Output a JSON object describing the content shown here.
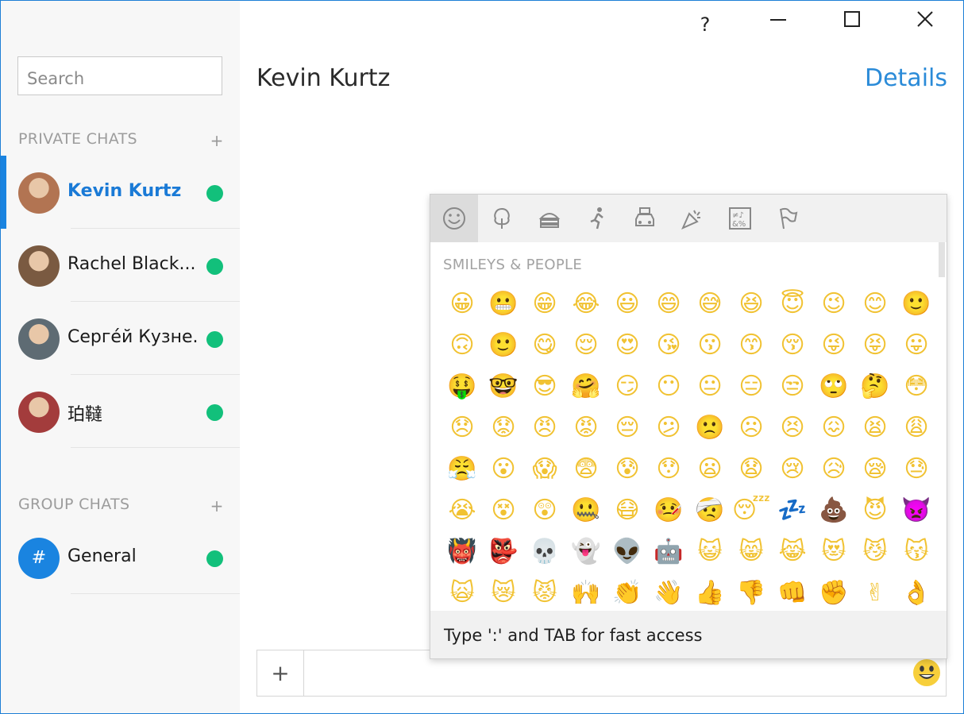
{
  "window": {
    "controls": {
      "help": "?",
      "minimize": "—",
      "maximize": "☐",
      "close": "✕"
    }
  },
  "sidebar": {
    "search_placeholder": "Search",
    "private_title": "PRIVATE CHATS",
    "group_title": "GROUP CHATS",
    "add_label": "+",
    "private_chats": [
      {
        "name": "Kevin Kurtz",
        "active": true,
        "online": true,
        "avatar_color": "#b27452"
      },
      {
        "name": "Rachel Black...",
        "active": false,
        "online": true,
        "avatar_color": "#7a5a41"
      },
      {
        "name": "Сергéй Кузне...",
        "active": false,
        "online": true,
        "avatar_color": "#5e6b73"
      },
      {
        "name": "珀韃",
        "active": false,
        "online": true,
        "avatar_color": "#a33c3c"
      }
    ],
    "group_chats": [
      {
        "name": "General",
        "symbol": "#",
        "online": true
      }
    ]
  },
  "header": {
    "title": "Kevin Kurtz",
    "details": "Details"
  },
  "composer": {
    "add_label": "+",
    "emoji_icon": "smiley-icon"
  },
  "picker": {
    "heading": "SMILEYS & PEOPLE",
    "hint": "Type ':' and TAB for fast access",
    "tabs": [
      "smiley-icon",
      "tree-icon",
      "food-icon",
      "running-icon",
      "car-icon",
      "party-icon",
      "symbols-icon",
      "flag-icon"
    ],
    "emojis": [
      "😀",
      "😬",
      "😁",
      "😂",
      "😃",
      "😄",
      "😅",
      "😆",
      "😇",
      "😉",
      "😊",
      "🙂",
      "🙃",
      "🙂",
      "😋",
      "😌",
      "😍",
      "😘",
      "😗",
      "😙",
      "😚",
      "😜",
      "😝",
      "😛",
      "🤑",
      "🤓",
      "😎",
      "🤗",
      "😏",
      "😶",
      "😐",
      "😑",
      "😒",
      "🙄",
      "🤔",
      "😳",
      "😞",
      "😟",
      "😠",
      "😡",
      "😔",
      "😕",
      "🙁",
      "☹",
      "😣",
      "😖",
      "😫",
      "😩",
      "😤",
      "😮",
      "😱",
      "😨",
      "😰",
      "😯",
      "😦",
      "😧",
      "😢",
      "😥",
      "😪",
      "😓",
      "😭",
      "😵",
      "😲",
      "🤐",
      "😷",
      "🤒",
      "🤕",
      "😴",
      "💤",
      "💩",
      "😈",
      "👿",
      "👹",
      "👺",
      "💀",
      "👻",
      "👽",
      "🤖",
      "😺",
      "😸",
      "😹",
      "😻",
      "😼",
      "😽",
      "🙀",
      "😿",
      "😾",
      "🙌",
      "👏",
      "👋",
      "👍",
      "👎",
      "👊",
      "✊",
      "✌",
      "👌"
    ]
  },
  "colors": {
    "accent": "#1a84e0",
    "online": "#12c07b",
    "emoji_yellow": "#f1c232"
  }
}
